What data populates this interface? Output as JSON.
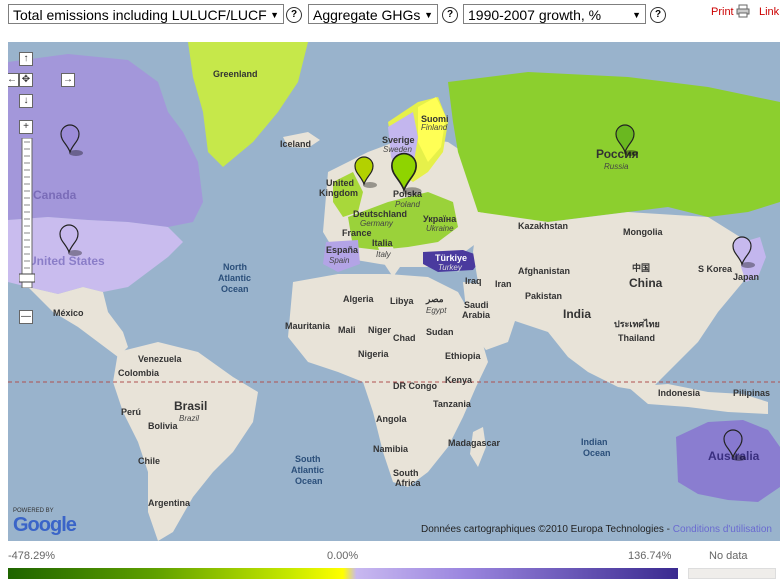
{
  "toolbar": {
    "indicator": "Total emissions including LULUCF/LUCF",
    "gas": "Aggregate GHGs",
    "period": "1990-2007 growth, %",
    "help_glyph": "?",
    "print_label": "Print",
    "link_label": "Link"
  },
  "map": {
    "nav": {
      "up": "↑",
      "left": "←",
      "center": "✥",
      "right": "→",
      "down": "↓",
      "zoom_in": "+",
      "zoom_out": "—"
    },
    "labels": {
      "greenland": "Greenland",
      "iceland": "Iceland",
      "suomi": "Suomi",
      "finland": "Finland",
      "sverige": "Sverige",
      "sweden": "Sweden",
      "russia_native": "Россия",
      "russia": "Russia",
      "united": "United",
      "kingdom": "Kingdom",
      "polska": "Polska",
      "poland": "Poland",
      "deutschland": "Deutschland",
      "germany": "Germany",
      "ukraina": "Україна",
      "ukraine": "Ukraine",
      "france": "France",
      "espana": "España",
      "spain": "Spain",
      "italia": "Italia",
      "italy": "Italy",
      "turkiye": "Türkiye",
      "turkey": "Turkey",
      "canada": "Canada",
      "united_states": "United States",
      "mexico": "México",
      "north_atlantic": [
        "North",
        "Atlantic",
        "Ocean"
      ],
      "south_atlantic": [
        "South",
        "Atlantic",
        "Ocean"
      ],
      "indian_ocean": [
        "Indian",
        "Ocean"
      ],
      "kazakhstan": "Kazakhstan",
      "mongolia": "Mongolia",
      "china_native": "中国",
      "china": "China",
      "korea": "S Korea",
      "japan": "Japan",
      "algeria": "Algeria",
      "libya": "Libya",
      "egypt_native": "مصر",
      "egypt": "Egypt",
      "saudi": [
        "Saudi",
        "Arabia"
      ],
      "iraq": "Iraq",
      "iran": "Iran",
      "afghanistan": "Afghanistan",
      "pakistan": "Pakistan",
      "india": "India",
      "thailand_native": "ประเทศไทย",
      "thailand": "Thailand",
      "mauritania": "Mauritania",
      "mali": "Mali",
      "niger": "Niger",
      "chad": "Chad",
      "sudan": "Sudan",
      "nigeria": "Nigeria",
      "ethiopia": "Ethiopia",
      "drcongo": "DR Congo",
      "kenya": "Kenya",
      "tanzania": "Tanzania",
      "angola": "Angola",
      "namibia": "Namibia",
      "madagascar": "Madagascar",
      "south_africa": [
        "South",
        "Africa"
      ],
      "venezuela": "Venezuela",
      "colombia": "Colombia",
      "peru": "Perú",
      "bolivia": "Bolivia",
      "brasil": "Brasil",
      "brazil": "Brazil",
      "chile": "Chile",
      "argentina": "Argentina",
      "indonesia": "Indonesia",
      "australia": "Australia",
      "philippines": "Pilipinas"
    },
    "markers": [
      {
        "name": "canada",
        "color": "#9c8cd8"
      },
      {
        "name": "united-states",
        "color": "#c7b9ee"
      },
      {
        "name": "united-kingdom",
        "color": "#b3d100"
      },
      {
        "name": "poland",
        "color": "#8fd400"
      },
      {
        "name": "russia",
        "color": "#6ab820"
      },
      {
        "name": "japan",
        "color": "#c7b9ee"
      },
      {
        "name": "australia",
        "color": "#8779cf"
      }
    ],
    "attribution": "Données cartographiques ©2010 Europa Technologies",
    "attribution_link": "Conditions d'utilisation",
    "powered_by": "POWERED BY",
    "google": "Google"
  },
  "legend": {
    "min": "-478.29%",
    "mid": "0.00%",
    "max": "136.74%",
    "no_data": "No data"
  }
}
